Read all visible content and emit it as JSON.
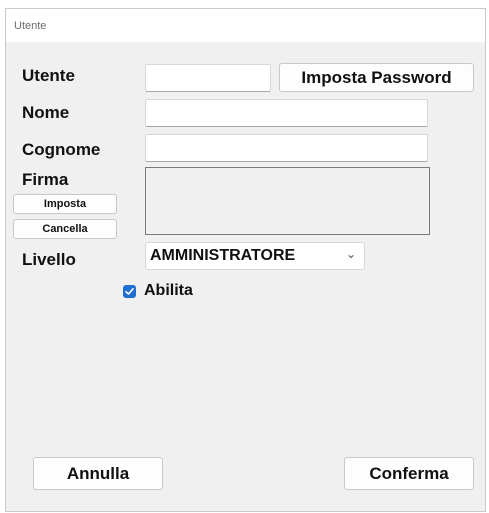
{
  "window": {
    "title": "Utente"
  },
  "form": {
    "utente_label": "Utente",
    "utente_value": "",
    "set_password_label": "Imposta Password",
    "nome_label": "Nome",
    "nome_value": "",
    "cognome_label": "Cognome",
    "cognome_value": "",
    "firma_label": "Firma",
    "firma_set_label": "Imposta",
    "firma_clear_label": "Cancella",
    "livello_label": "Livello",
    "livello_selected": "AMMINISTRATORE",
    "abilita_label": "Abilita",
    "abilita_checked": true
  },
  "footer": {
    "cancel_label": "Annulla",
    "confirm_label": "Conferma"
  },
  "icons": {
    "dropdown": "chevron-down-icon",
    "checkbox": "checkmark-icon"
  },
  "colors": {
    "window_background": "#f0f0f0",
    "checkbox_accent": "#1f6fd1"
  }
}
